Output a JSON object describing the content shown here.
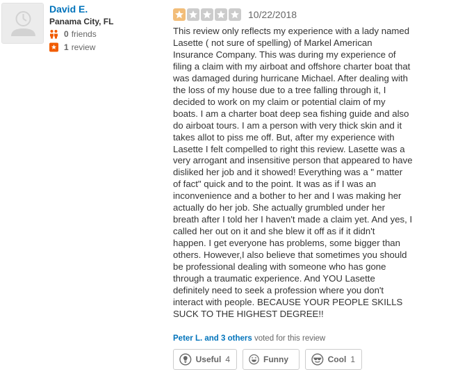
{
  "user": {
    "name": "David E.",
    "location": "Panama City, FL",
    "friends_count": "0",
    "friends_label": "friends",
    "reviews_count": "1",
    "reviews_label": "review"
  },
  "review": {
    "rating": 1,
    "rating_max": 5,
    "date": "10/22/2018",
    "text": "This review only reflects my experience with a lady named\nLasette ( not sure of  spelling) of Markel American\nInsurance Company. This was during my experience of\nfiling a claim with my airboat and offshore charter boat that\nwas damaged during hurricane Michael. After dealing with\nthe loss of my house due to a tree falling through it, I\ndecided to work on my claim or potential claim of my\nboats. I am a charter boat deep sea fishing guide and also\ndo airboat tours. I am a person with very thick skin and it\ntakes allot to piss me off. But, after my experience with\nLasette I felt compelled to right this review. Lasette was a\nvery arrogant and insensitive person that appeared to have\ndisliked her job and it showed! Everything was a \" matter\nof fact\" quick and to the point. It was as if I was an\ninconvenience and a bother to her and I was making her\nactually do her job. She actually grumbled under her\nbreath after I told her I haven't made a claim yet. And yes, I\ncalled her out on it and she blew it off as if it didn't\nhappen. I get everyone has problems, some bigger than\nothers. However,I also believe that sometimes you should\nbe professional dealing with someone who has gone\nthrough a traumatic experience. And YOU Lasette\ndefinitely need to seek a profession where you don't\ninteract with people. BECAUSE YOUR PEOPLE SKILLS\nSUCK TO THE HIGHEST DEGREE!!"
  },
  "votes": {
    "voters": "Peter L. and 3 others",
    "voted_suffix": " voted for this review",
    "useful_label": "Useful",
    "useful_count": "4",
    "funny_label": "Funny",
    "funny_count": "",
    "cool_label": "Cool",
    "cool_count": "1"
  },
  "colors": {
    "link_blue": "#0073bb",
    "star_filled": "#f2bd79",
    "star_empty": "#cccccc",
    "review_badge": "#f15c00",
    "friends_icon": "#f15c00"
  }
}
